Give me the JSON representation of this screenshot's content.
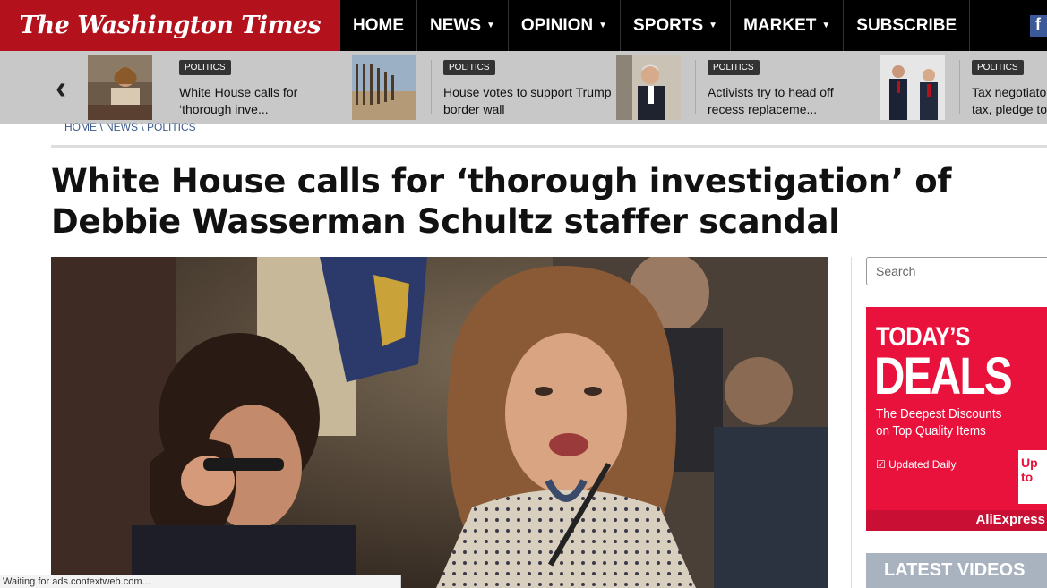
{
  "site": {
    "logo": "The Washington Times"
  },
  "nav": {
    "items": [
      {
        "label": "HOME",
        "dropdown": false
      },
      {
        "label": "NEWS",
        "dropdown": true
      },
      {
        "label": "OPINION",
        "dropdown": true
      },
      {
        "label": "SPORTS",
        "dropdown": true
      },
      {
        "label": "MARKET",
        "dropdown": true
      },
      {
        "label": "SUBSCRIBE",
        "dropdown": false
      }
    ],
    "facebook_glyph": "f"
  },
  "carousel": {
    "prev_icon": "chevron-left-icon",
    "cards": [
      {
        "badge": "POLITICS",
        "line1": "White House calls for",
        "line2": "‘thorough inve..."
      },
      {
        "badge": "POLITICS",
        "line1": "House votes to support Trump",
        "line2": "border wall"
      },
      {
        "badge": "POLITICS",
        "line1": "Activists try to head off",
        "line2": "recess replaceme..."
      },
      {
        "badge": "POLITICS",
        "line1": "Tax negotiato",
        "line2": "tax, pledge to"
      }
    ]
  },
  "breadcrumb": "HOME \\ NEWS \\ POLITICS",
  "article": {
    "headline": "White House calls for ‘thorough investigation’ of Debbie Wasserman Schultz staffer scandal"
  },
  "sidebar": {
    "search_placeholder": "Search",
    "ad": {
      "line1": "TODAY’S",
      "line2": "DEALS",
      "sub1": "The Deepest Discounts",
      "sub2": "on Top Quality Items",
      "updated": "Updated Daily",
      "upto": "Up to",
      "brand": "AliExpress"
    },
    "latest_videos": "LATEST VIDEOS"
  },
  "status_bar": "Waiting for ads.contextweb.com...",
  "colors": {
    "brand_red": "#b3121d",
    "nav_black": "#000000",
    "strip_gray": "#c8c8c8",
    "ad_red": "#e8123c"
  }
}
